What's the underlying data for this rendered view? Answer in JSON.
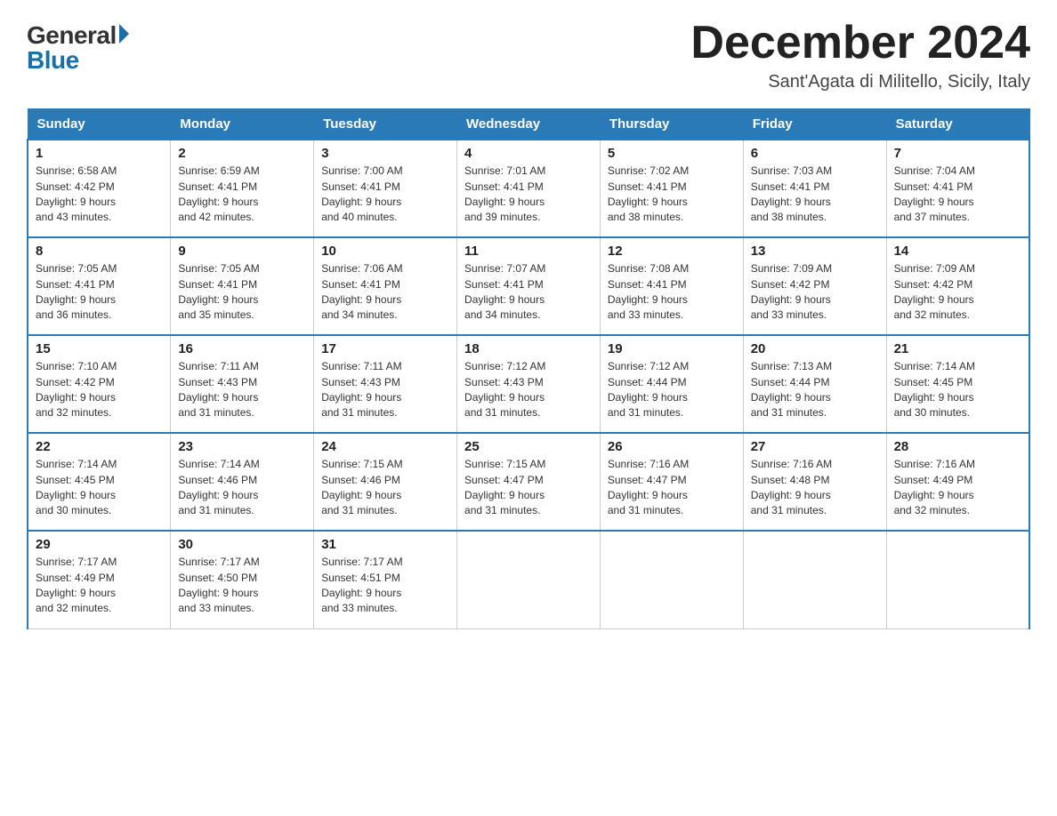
{
  "logo": {
    "general": "General",
    "blue": "Blue"
  },
  "header": {
    "month_year": "December 2024",
    "location": "Sant'Agata di Militello, Sicily, Italy"
  },
  "days_of_week": [
    "Sunday",
    "Monday",
    "Tuesday",
    "Wednesday",
    "Thursday",
    "Friday",
    "Saturday"
  ],
  "weeks": [
    [
      {
        "day": "1",
        "sunrise": "6:58 AM",
        "sunset": "4:42 PM",
        "daylight": "9 hours and 43 minutes."
      },
      {
        "day": "2",
        "sunrise": "6:59 AM",
        "sunset": "4:41 PM",
        "daylight": "9 hours and 42 minutes."
      },
      {
        "day": "3",
        "sunrise": "7:00 AM",
        "sunset": "4:41 PM",
        "daylight": "9 hours and 40 minutes."
      },
      {
        "day": "4",
        "sunrise": "7:01 AM",
        "sunset": "4:41 PM",
        "daylight": "9 hours and 39 minutes."
      },
      {
        "day": "5",
        "sunrise": "7:02 AM",
        "sunset": "4:41 PM",
        "daylight": "9 hours and 38 minutes."
      },
      {
        "day": "6",
        "sunrise": "7:03 AM",
        "sunset": "4:41 PM",
        "daylight": "9 hours and 38 minutes."
      },
      {
        "day": "7",
        "sunrise": "7:04 AM",
        "sunset": "4:41 PM",
        "daylight": "9 hours and 37 minutes."
      }
    ],
    [
      {
        "day": "8",
        "sunrise": "7:05 AM",
        "sunset": "4:41 PM",
        "daylight": "9 hours and 36 minutes."
      },
      {
        "day": "9",
        "sunrise": "7:05 AM",
        "sunset": "4:41 PM",
        "daylight": "9 hours and 35 minutes."
      },
      {
        "day": "10",
        "sunrise": "7:06 AM",
        "sunset": "4:41 PM",
        "daylight": "9 hours and 34 minutes."
      },
      {
        "day": "11",
        "sunrise": "7:07 AM",
        "sunset": "4:41 PM",
        "daylight": "9 hours and 34 minutes."
      },
      {
        "day": "12",
        "sunrise": "7:08 AM",
        "sunset": "4:41 PM",
        "daylight": "9 hours and 33 minutes."
      },
      {
        "day": "13",
        "sunrise": "7:09 AM",
        "sunset": "4:42 PM",
        "daylight": "9 hours and 33 minutes."
      },
      {
        "day": "14",
        "sunrise": "7:09 AM",
        "sunset": "4:42 PM",
        "daylight": "9 hours and 32 minutes."
      }
    ],
    [
      {
        "day": "15",
        "sunrise": "7:10 AM",
        "sunset": "4:42 PM",
        "daylight": "9 hours and 32 minutes."
      },
      {
        "day": "16",
        "sunrise": "7:11 AM",
        "sunset": "4:43 PM",
        "daylight": "9 hours and 31 minutes."
      },
      {
        "day": "17",
        "sunrise": "7:11 AM",
        "sunset": "4:43 PM",
        "daylight": "9 hours and 31 minutes."
      },
      {
        "day": "18",
        "sunrise": "7:12 AM",
        "sunset": "4:43 PM",
        "daylight": "9 hours and 31 minutes."
      },
      {
        "day": "19",
        "sunrise": "7:12 AM",
        "sunset": "4:44 PM",
        "daylight": "9 hours and 31 minutes."
      },
      {
        "day": "20",
        "sunrise": "7:13 AM",
        "sunset": "4:44 PM",
        "daylight": "9 hours and 31 minutes."
      },
      {
        "day": "21",
        "sunrise": "7:14 AM",
        "sunset": "4:45 PM",
        "daylight": "9 hours and 30 minutes."
      }
    ],
    [
      {
        "day": "22",
        "sunrise": "7:14 AM",
        "sunset": "4:45 PM",
        "daylight": "9 hours and 30 minutes."
      },
      {
        "day": "23",
        "sunrise": "7:14 AM",
        "sunset": "4:46 PM",
        "daylight": "9 hours and 31 minutes."
      },
      {
        "day": "24",
        "sunrise": "7:15 AM",
        "sunset": "4:46 PM",
        "daylight": "9 hours and 31 minutes."
      },
      {
        "day": "25",
        "sunrise": "7:15 AM",
        "sunset": "4:47 PM",
        "daylight": "9 hours and 31 minutes."
      },
      {
        "day": "26",
        "sunrise": "7:16 AM",
        "sunset": "4:47 PM",
        "daylight": "9 hours and 31 minutes."
      },
      {
        "day": "27",
        "sunrise": "7:16 AM",
        "sunset": "4:48 PM",
        "daylight": "9 hours and 31 minutes."
      },
      {
        "day": "28",
        "sunrise": "7:16 AM",
        "sunset": "4:49 PM",
        "daylight": "9 hours and 32 minutes."
      }
    ],
    [
      {
        "day": "29",
        "sunrise": "7:17 AM",
        "sunset": "4:49 PM",
        "daylight": "9 hours and 32 minutes."
      },
      {
        "day": "30",
        "sunrise": "7:17 AM",
        "sunset": "4:50 PM",
        "daylight": "9 hours and 33 minutes."
      },
      {
        "day": "31",
        "sunrise": "7:17 AM",
        "sunset": "4:51 PM",
        "daylight": "9 hours and 33 minutes."
      },
      null,
      null,
      null,
      null
    ]
  ],
  "labels": {
    "sunrise": "Sunrise:",
    "sunset": "Sunset:",
    "daylight": "Daylight:"
  }
}
